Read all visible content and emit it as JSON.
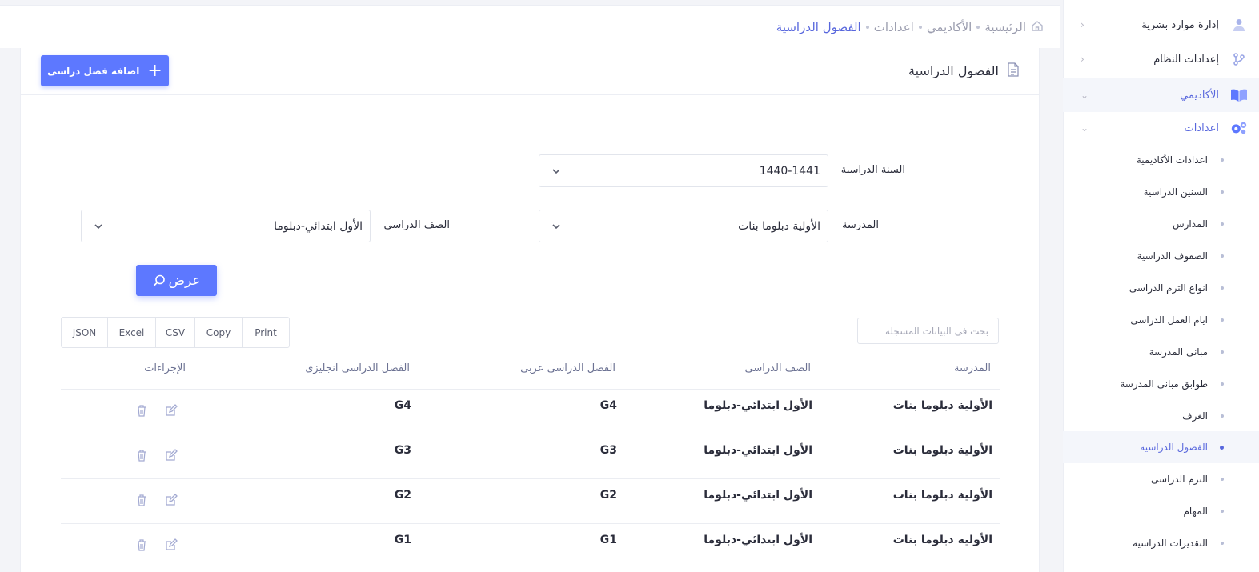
{
  "breadcrumb": {
    "items": [
      "الرئيسية",
      "الأكاديمي",
      "اعدادات",
      "الفصول الدراسية"
    ]
  },
  "sidebar": {
    "sections": [
      {
        "label": "إدارة موارد بشرية",
        "icon": "user-icon"
      },
      {
        "label": "إعدادات النظام",
        "icon": "git-branch-icon"
      },
      {
        "label": "الأكاديمي",
        "icon": "book-icon"
      },
      {
        "label": "اعدادات",
        "icon": "gears-icon"
      }
    ],
    "subitems": [
      "اعدادات الأكاديمية",
      "السنين الدراسية",
      "المدارس",
      "الصفوف الدراسية",
      "انواع الترم الدراسى",
      "ايام العمل الدراسى",
      "مبانى المدرسة",
      "طوابق مبانى المدرسة",
      "الغرف",
      "الفصول الدراسية",
      "الترم الدراسى",
      "المهام",
      "التقديرات الدراسية"
    ]
  },
  "card": {
    "title": "الفصول الدراسية",
    "add_button": "اضافة فصل دراسى"
  },
  "filters": {
    "year_label": "السنة الدراسية",
    "year_value": "1440-1441",
    "school_label": "المدرسة",
    "school_value": "الأولية دبلوما بنات",
    "grade_label": "الصف الدراسى",
    "grade_value": "الأول ابتدائي-دبلوما",
    "view_button": "عرض"
  },
  "export": [
    "Print",
    "Copy",
    "CSV",
    "Excel",
    "JSON"
  ],
  "search": {
    "placeholder": "بحث فى البيانات المسجلة"
  },
  "table": {
    "headers": {
      "school": "المدرسة",
      "grade": "الصف الدراسى",
      "class_ar": "الفصل الدراسى عربى",
      "class_en": "الفصل الدراسى انجليزى",
      "actions": "الإجراءات"
    },
    "rows": [
      {
        "school": "الأولية دبلوما بنات",
        "grade": "الأول ابتدائي-دبلوما",
        "class_ar": "G4",
        "class_en": "G4"
      },
      {
        "school": "الأولية دبلوما بنات",
        "grade": "الأول ابتدائي-دبلوما",
        "class_ar": "G3",
        "class_en": "G3"
      },
      {
        "school": "الأولية دبلوما بنات",
        "grade": "الأول ابتدائي-دبلوما",
        "class_ar": "G2",
        "class_en": "G2"
      },
      {
        "school": "الأولية دبلوما بنات",
        "grade": "الأول ابتدائي-دبلوما",
        "class_ar": "G1",
        "class_en": "G1"
      }
    ]
  },
  "colors": {
    "accent": "#5d78ff",
    "active_text": "#5867dd"
  }
}
